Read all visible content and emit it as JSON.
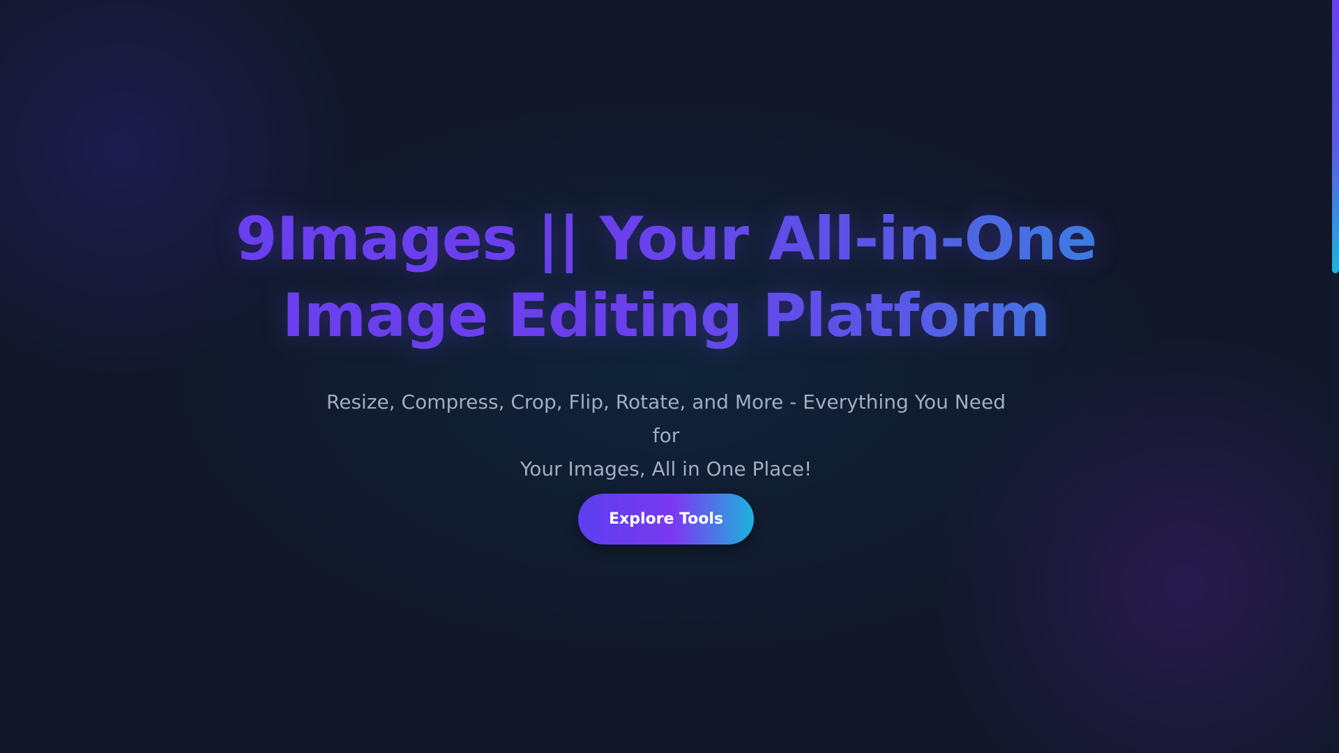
{
  "hero": {
    "title_line1": "9Images || Your All-in-One",
    "title_line2": "Image Editing Platform",
    "subtitle_line1": "Resize, Compress, Crop, Flip, Rotate, and More - Everything You Need for",
    "subtitle_line2": "Your Images, All in One Place!",
    "cta_label": "Explore Tools"
  },
  "colors": {
    "background": "#111729",
    "title_gradient_start": "#6a3ff0",
    "title_gradient_end": "#2f8fdc",
    "subtitle": "#a3acc0",
    "button_gradient_start": "#5c3ff0",
    "button_gradient_end": "#1eb3dc",
    "button_text": "#ffffff"
  }
}
